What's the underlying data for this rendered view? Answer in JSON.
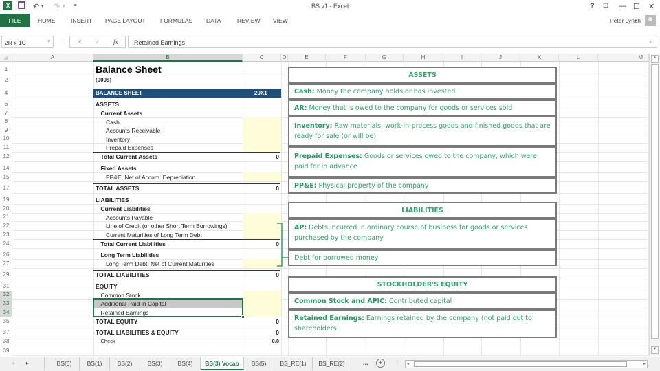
{
  "window": {
    "title": "BS v1 - Excel",
    "help": "?",
    "restore_ribbon": "⊡",
    "minimize": "—",
    "maximize": "☐",
    "close": "✕",
    "user": "Peter Lynch"
  },
  "qat": {
    "excel_icon": "X",
    "save": "💾",
    "undo": "↶",
    "redo": "↷",
    "customize": "="
  },
  "ribbon_tabs": [
    "FILE",
    "HOME",
    "INSERT",
    "PAGE LAYOUT",
    "FORMULAS",
    "DATA",
    "REVIEW",
    "VIEW"
  ],
  "formula_bar": {
    "name_box": "2R x 1C",
    "cancel": "✕",
    "enter": "✓",
    "fx": "fx",
    "formula": "Retained Earnings"
  },
  "columns": [
    "A",
    "B",
    "C",
    "D",
    "E",
    "F",
    "G",
    "H",
    "I",
    "J",
    "K",
    "L",
    "M"
  ],
  "selected_column": "B",
  "rows": [
    "1",
    "2",
    "4",
    "6",
    "7",
    "8",
    "9",
    "10",
    "11",
    "12",
    "14",
    "15",
    "17",
    "19",
    "20",
    "21",
    "22",
    "23",
    "24",
    "26",
    "27",
    "29",
    "31",
    "32",
    "33",
    "34",
    "35",
    "37",
    "38",
    "39"
  ],
  "selected_rows": [
    "32",
    "33",
    "34"
  ],
  "sheet": {
    "title": "Balance Sheet",
    "units": "(000s)",
    "header_label": "BALANCE SHEET",
    "header_year": "20X1",
    "header_color": "#1f4e79",
    "lines": [
      {
        "row": "6",
        "label": "ASSETS",
        "bold": true,
        "indent": 0
      },
      {
        "row": "7",
        "label": "Current Assets",
        "bold": true,
        "indent": 1
      },
      {
        "row": "8",
        "label": "Cash",
        "bold": false,
        "indent": 2
      },
      {
        "row": "9",
        "label": "Accounts Receivable",
        "bold": false,
        "indent": 2
      },
      {
        "row": "10",
        "label": "Inventory",
        "bold": false,
        "indent": 2
      },
      {
        "row": "11",
        "label": "Prepaid Expenses",
        "bold": false,
        "indent": 2
      },
      {
        "row": "12",
        "label": "Total Current Assets",
        "bold": true,
        "indent": 1,
        "value": "0"
      },
      {
        "row": "14",
        "label": "Fixed Assets",
        "bold": true,
        "indent": 1
      },
      {
        "row": "15",
        "label": "PP&E, Net of Accum. Depreciation",
        "bold": false,
        "indent": 2
      },
      {
        "row": "17",
        "label": "TOTAL ASSETS",
        "bold": true,
        "indent": 0,
        "value": "0"
      },
      {
        "row": "19",
        "label": "LIABILITIES",
        "bold": true,
        "indent": 0
      },
      {
        "row": "20",
        "label": "Current Liabilities",
        "bold": true,
        "indent": 1
      },
      {
        "row": "21",
        "label": "Accounts Payable",
        "bold": false,
        "indent": 2
      },
      {
        "row": "22",
        "label": "Line of Credit (or other Short Term Borrowings)",
        "bold": false,
        "indent": 2
      },
      {
        "row": "23",
        "label": "Current Maturities of Long Term Debt",
        "bold": false,
        "indent": 2
      },
      {
        "row": "24",
        "label": "Total Current Liabilities",
        "bold": true,
        "indent": 1,
        "value": "0"
      },
      {
        "row": "26",
        "label": "Long Term Liabilities",
        "bold": true,
        "indent": 1
      },
      {
        "row": "27",
        "label": "Long Term Debt, Net of Current Maturities",
        "bold": false,
        "indent": 2
      },
      {
        "row": "29",
        "label": "TOTAL LIABILITIES",
        "bold": true,
        "indent": 0,
        "value": "0"
      },
      {
        "row": "31",
        "label": "EQUITY",
        "bold": true,
        "indent": 0
      },
      {
        "row": "32",
        "label": "Common Stock",
        "bold": false,
        "indent": 1
      },
      {
        "row": "33",
        "label": "Additional Paid In Capital",
        "bold": false,
        "indent": 1
      },
      {
        "row": "34",
        "label": "Retained Earnings",
        "bold": false,
        "indent": 1
      },
      {
        "row": "35",
        "label": "TOTAL EQUITY",
        "bold": true,
        "indent": 0,
        "value": "0"
      },
      {
        "row": "37",
        "label": "TOTAL LIABILITIES & EQUITY",
        "bold": true,
        "indent": 0,
        "value": "0"
      },
      {
        "row": "38",
        "label": "Check",
        "bold": false,
        "indent": 1,
        "value": "0.0",
        "small": true
      }
    ]
  },
  "vocab": {
    "assets_header": "ASSETS",
    "cash_term": "Cash:",
    "cash_def": " Money the company holds or has invested",
    "ar_term": "AR:",
    "ar_def": " Money that is owed to the company for goods or services sold",
    "inv_term": "Inventory:",
    "inv_def": " Raw materials, work-in-process goods and finished goods that are ready for sale (or will be)",
    "prepaid_term": "Prepaid Expenses:",
    "prepaid_def": " Goods or services owed to the company, which were paid for in advance",
    "ppe_term": "PP&E:",
    "ppe_def": " Physical property of the company",
    "liab_header": "LIABILITIES",
    "ap_term": "AP:",
    "ap_def": " Debts incurred in ordinary course of business for goods or services purchased by the company",
    "debt_def": "Debt for borrowed money",
    "equity_header": "STOCKHOLDER'S EQUITY",
    "cs_term": "Common Stock and APIC:",
    "cs_def": " Contributed capital",
    "re_term": "Retained Earnings:",
    "re_def": " Earnings retained by the company (not paid out to shareholders",
    "text_color": "#2ea36a"
  },
  "sheet_tabs": [
    "BS(0)",
    "BS(1)",
    "BS(2)",
    "BS(3)",
    "BS(4)",
    "BS(3) Vocab",
    "BS(5)",
    "BS_RE(1)",
    "BS_RE(2)"
  ],
  "active_tab": "BS(3) Vocab",
  "more_tabs": "...",
  "add_sheet": "+",
  "accent_color": "#217346"
}
